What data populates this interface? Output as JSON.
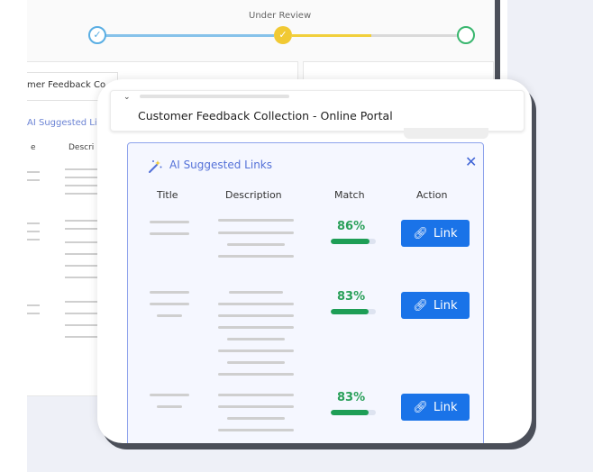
{
  "stepper": {
    "current_label": "Under Review",
    "steps": [
      {
        "state": "done",
        "icon": "check-icon"
      },
      {
        "state": "current",
        "icon": "check-icon"
      },
      {
        "state": "pending",
        "icon": "circle-icon"
      }
    ]
  },
  "background": {
    "field_text": "mer Feedback Co",
    "section_title": "AI Suggested Lir",
    "col_title_fragment": "e",
    "col_desc_fragment": "Descri"
  },
  "card": {
    "title": "Customer Feedback Collection - Online Portal"
  },
  "suggested_links": {
    "title": "AI Suggested Links",
    "columns": {
      "title": "Title",
      "description": "Description",
      "match": "Match",
      "action": "Action"
    },
    "rows": [
      {
        "match": "86%",
        "match_fraction": 0.86,
        "action": "Link"
      },
      {
        "match": "83%",
        "match_fraction": 0.83,
        "action": "Link"
      },
      {
        "match": "83%",
        "match_fraction": 0.83,
        "action": "Link"
      }
    ]
  },
  "colors": {
    "accent": "#1a73e8",
    "panel_title": "#5471d8",
    "match_green": "#2aa05a",
    "step_done": "#5aaee3",
    "step_current": "#f1c933",
    "step_pending": "#39b66e"
  }
}
